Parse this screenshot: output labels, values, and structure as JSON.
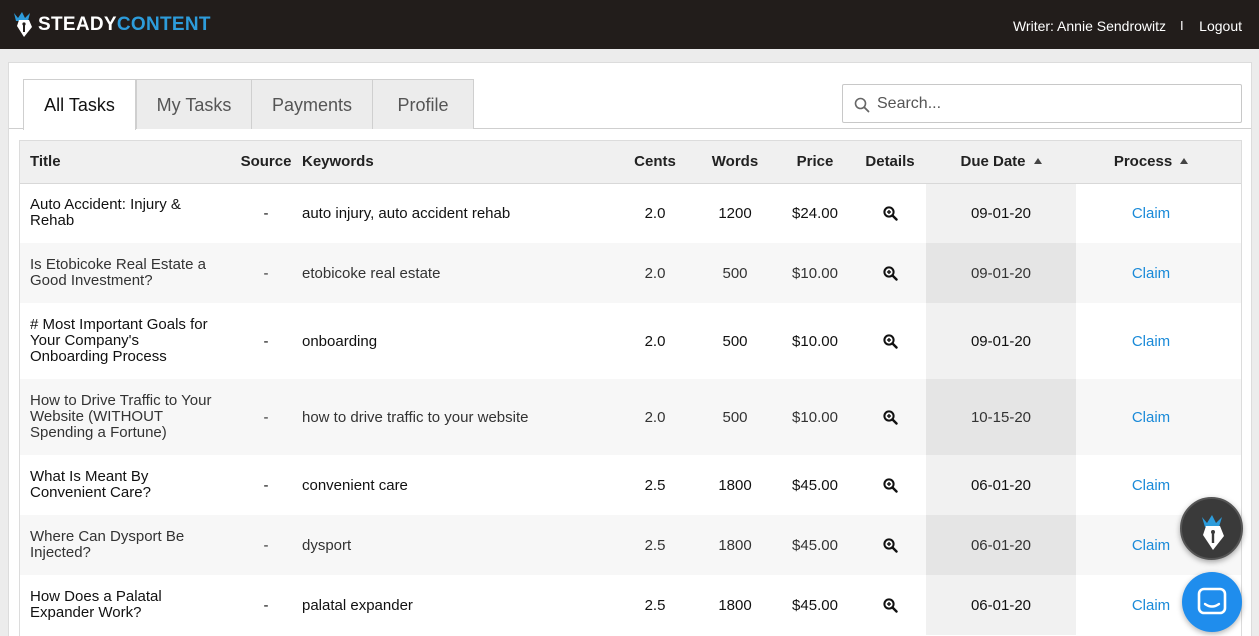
{
  "header": {
    "logo_part1": "STEADY",
    "logo_part2": "CONTENT",
    "user_label": "Writer: Annie Sendrowitz",
    "separator": "I",
    "logout_label": "Logout"
  },
  "tabs": [
    {
      "label": "All Tasks",
      "active": true
    },
    {
      "label": "My Tasks",
      "active": false
    },
    {
      "label": "Payments",
      "active": false
    },
    {
      "label": "Profile",
      "active": false
    }
  ],
  "search": {
    "placeholder": "Search..."
  },
  "table": {
    "columns": [
      "Title",
      "Source",
      "Keywords",
      "Cents",
      "Words",
      "Price",
      "Details",
      "Due Date",
      "Process"
    ],
    "rows": [
      {
        "title": "Auto Accident: Injury & Rehab",
        "source": "-",
        "keywords": "auto injury, auto accident rehab",
        "cents": "2.0",
        "words": "1200",
        "price": "$24.00",
        "due": "09-01-20",
        "process": "Claim"
      },
      {
        "title": "Is Etobicoke Real Estate a Good Investment?",
        "source": "-",
        "keywords": "etobicoke real estate",
        "cents": "2.0",
        "words": "500",
        "price": "$10.00",
        "due": "09-01-20",
        "process": "Claim"
      },
      {
        "title": "# Most Important Goals for Your Company's Onboarding Process",
        "source": "-",
        "keywords": "onboarding",
        "cents": "2.0",
        "words": "500",
        "price": "$10.00",
        "due": "09-01-20",
        "process": "Claim"
      },
      {
        "title": "How to Drive Traffic to Your Website (WITHOUT Spending a Fortune)",
        "source": "-",
        "keywords": "how to drive traffic to your website",
        "cents": "2.0",
        "words": "500",
        "price": "$10.00",
        "due": "10-15-20",
        "process": "Claim"
      },
      {
        "title": "What Is Meant By Convenient Care?",
        "source": "-",
        "keywords": "convenient care",
        "cents": "2.5",
        "words": "1800",
        "price": "$45.00",
        "due": "06-01-20",
        "process": "Claim"
      },
      {
        "title": "Where Can Dysport Be Injected?",
        "source": "-",
        "keywords": "dysport",
        "cents": "2.5",
        "words": "1800",
        "price": "$45.00",
        "due": "06-01-20",
        "process": "Claim"
      },
      {
        "title": "How Does a Palatal Expander Work?",
        "source": "-",
        "keywords": "palatal expander",
        "cents": "2.5",
        "words": "1800",
        "price": "$45.00",
        "due": "06-01-20",
        "process": "Claim"
      }
    ]
  },
  "icons": {
    "logo": "pen-crown-logo-icon",
    "search": "search-icon",
    "details": "magnifier-plus-icon",
    "sort": "sort-ascending-icon",
    "chat": "chat-icon"
  },
  "colors": {
    "header_bg": "#221d1b",
    "brand_blue": "#2d9cdb",
    "link": "#1a8ad8",
    "chat_button": "#1f8ded"
  }
}
